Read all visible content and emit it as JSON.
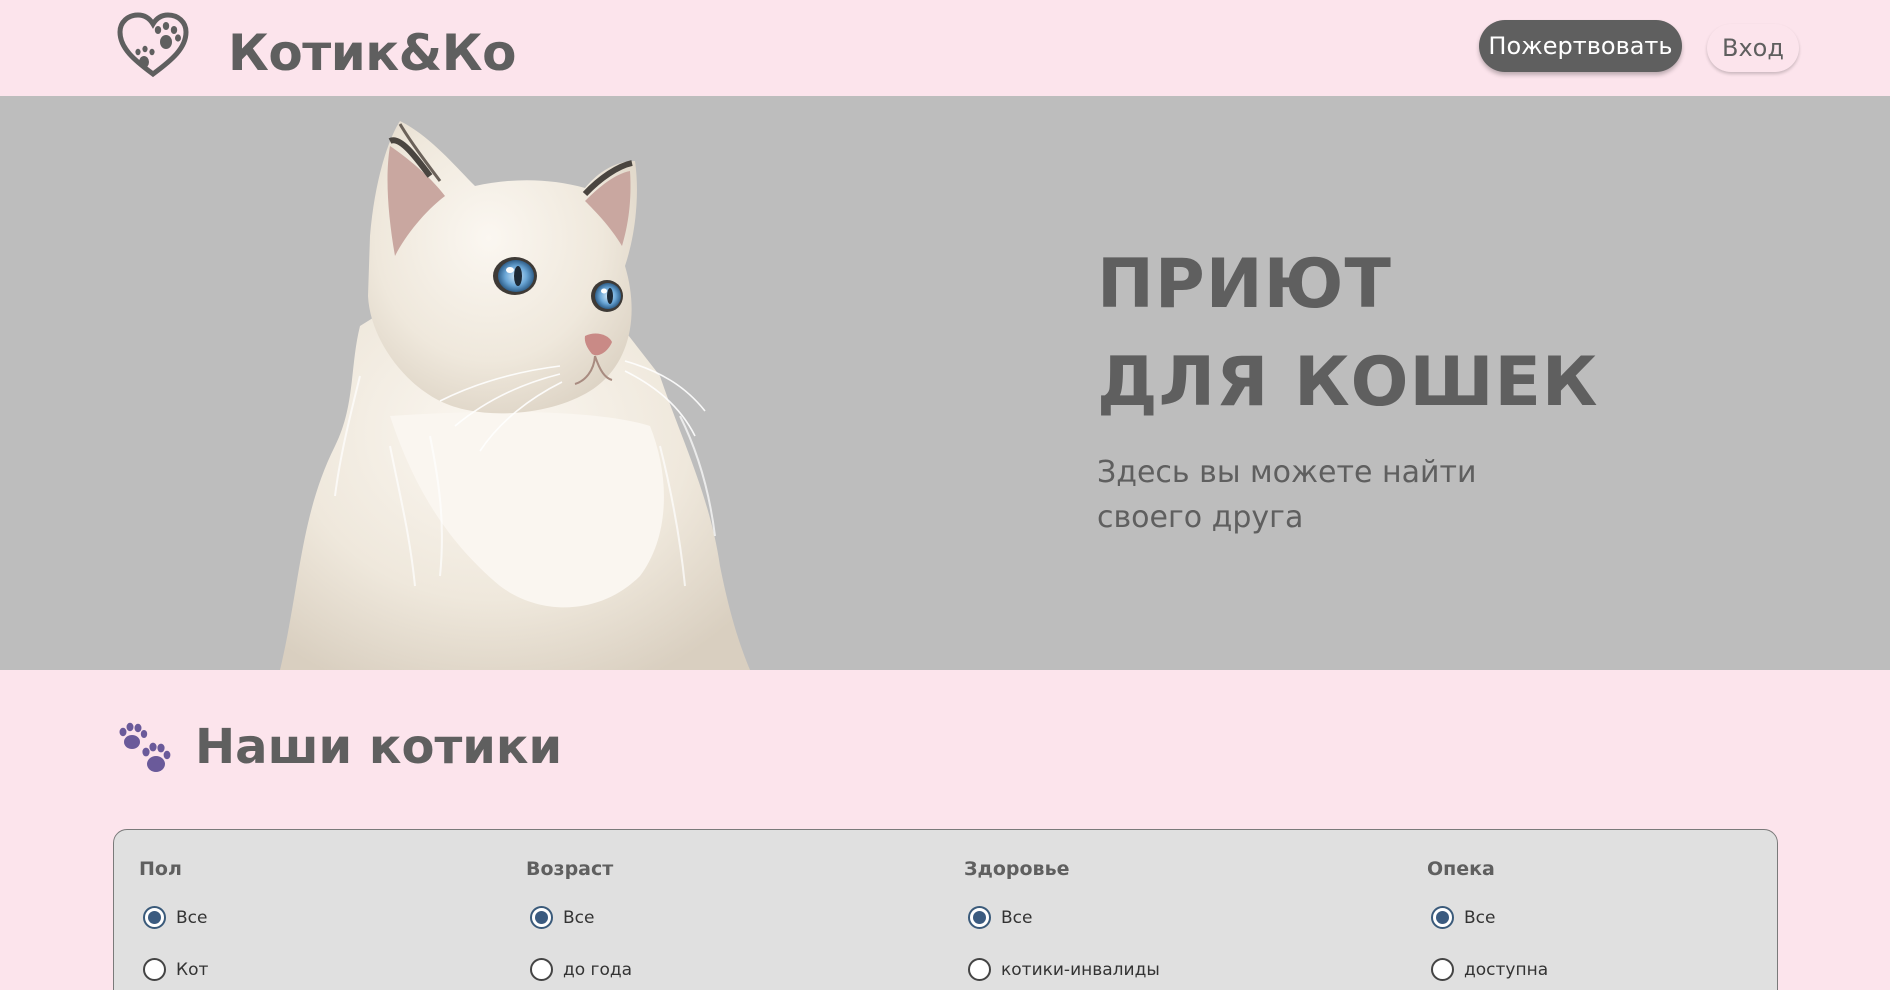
{
  "header": {
    "brand": "Котик&Ко",
    "donate_label": "Пожертвовать",
    "login_label": "Вход"
  },
  "hero": {
    "title_line1": "ПРИЮТ",
    "title_line2": "ДЛЯ КОШЕК",
    "subtitle_line1": "Здесь вы можете найти",
    "subtitle_line2": "своего друга"
  },
  "section": {
    "title": "Наши котики"
  },
  "filters": [
    {
      "label": "Пол",
      "options": [
        {
          "text": "Все",
          "checked": true
        },
        {
          "text": "Кот",
          "checked": false
        }
      ]
    },
    {
      "label": "Возраст",
      "options": [
        {
          "text": "Все",
          "checked": true
        },
        {
          "text": "до года",
          "checked": false
        }
      ]
    },
    {
      "label": "Здоровье",
      "options": [
        {
          "text": "Все",
          "checked": true
        },
        {
          "text": "котики-инвалиды",
          "checked": false
        }
      ]
    },
    {
      "label": "Опека",
      "options": [
        {
          "text": "Все",
          "checked": true
        },
        {
          "text": "доступна",
          "checked": false
        }
      ]
    }
  ],
  "colors": {
    "page_bg": "#fce4ec",
    "hero_bg": "#bdbdbd",
    "text": "#5f5f5f",
    "paw_accent": "#6a5a9a",
    "radio_checked": "#3b5b80"
  }
}
